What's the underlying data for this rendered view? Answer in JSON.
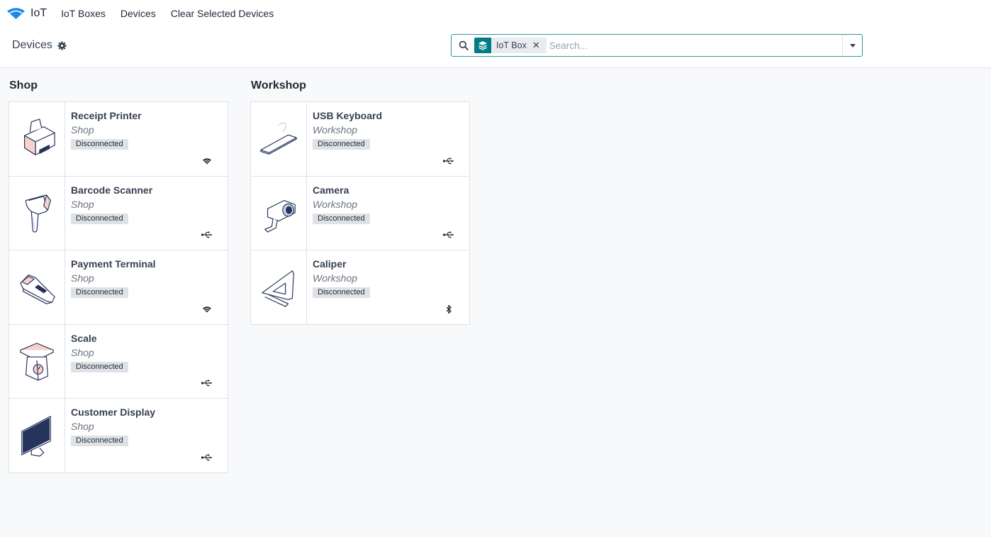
{
  "nav": {
    "app_name": "IoT",
    "links": [
      "IoT Boxes",
      "Devices",
      "Clear Selected Devices"
    ]
  },
  "control": {
    "title": "Devices",
    "search": {
      "facet_label": "IoT Box",
      "placeholder": "Search..."
    }
  },
  "groups": [
    {
      "title": "Shop",
      "devices": [
        {
          "name": "Receipt Printer",
          "location": "Shop",
          "status": "Disconnected",
          "icon": "printer-icon",
          "connection": "wifi-icon"
        },
        {
          "name": "Barcode Scanner",
          "location": "Shop",
          "status": "Disconnected",
          "icon": "barcode-scanner-icon",
          "connection": "usb-icon"
        },
        {
          "name": "Payment Terminal",
          "location": "Shop",
          "status": "Disconnected",
          "icon": "payment-terminal-icon",
          "connection": "wifi-icon"
        },
        {
          "name": "Scale",
          "location": "Shop",
          "status": "Disconnected",
          "icon": "scale-icon",
          "connection": "usb-icon"
        },
        {
          "name": "Customer Display",
          "location": "Shop",
          "status": "Disconnected",
          "icon": "display-icon",
          "connection": "usb-icon"
        }
      ]
    },
    {
      "title": "Workshop",
      "devices": [
        {
          "name": "USB Keyboard",
          "location": "Workshop",
          "status": "Disconnected",
          "icon": "keyboard-icon",
          "connection": "usb-icon"
        },
        {
          "name": "Camera",
          "location": "Workshop",
          "status": "Disconnected",
          "icon": "camera-icon",
          "connection": "usb-icon"
        },
        {
          "name": "Caliper",
          "location": "Workshop",
          "status": "Disconnected",
          "icon": "caliper-icon",
          "connection": "bluetooth-icon"
        }
      ]
    }
  ],
  "colors": {
    "accent": "#017e84",
    "search_border": "#2f9a94",
    "badge_bg": "#dee2e6",
    "brand_blue": "#1e88e5",
    "illustration_pink": "#f8d2cc",
    "illustration_navy": "#26335c"
  }
}
